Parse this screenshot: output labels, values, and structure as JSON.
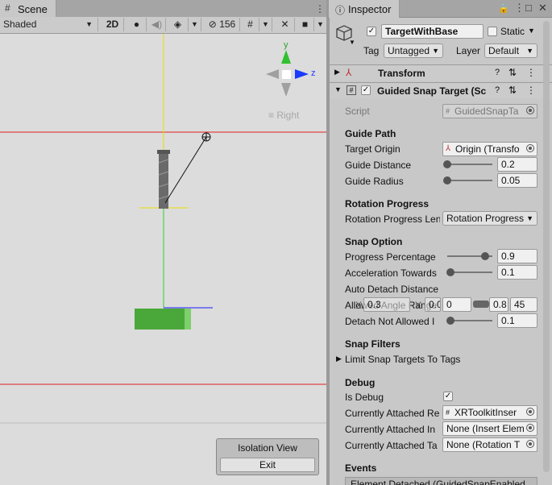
{
  "scene": {
    "tab_label": "Scene",
    "shading_mode": "Shaded",
    "mode_2d": "2D",
    "hidden_count": "156",
    "gizmo_view_label": "Right",
    "gizmo_axis_y": "y",
    "gizmo_axis_z": "z",
    "isolation_title": "Isolation View",
    "isolation_exit": "Exit"
  },
  "inspector": {
    "tab_label": "Inspector",
    "object_name": "TargetWithBase",
    "static_label": "Static",
    "tag_label": "Tag",
    "tag_value": "Untagged",
    "layer_label": "Layer",
    "layer_value": "Default",
    "transform_title": "Transform",
    "component_title": "Guided Snap Target (Sc",
    "script_label": "Script",
    "script_value": "GuidedSnapTa",
    "sections": {
      "guide_path": "Guide Path",
      "rotation_progress": "Rotation Progress",
      "snap_option": "Snap Option",
      "snap_filters": "Snap Filters",
      "debug": "Debug",
      "events": "Events"
    },
    "target_origin_label": "Target Origin",
    "target_origin_value": "Origin (Transfo",
    "guide_distance_label": "Guide Distance",
    "guide_distance_value": "0.2",
    "guide_radius_label": "Guide Radius",
    "guide_radius_value": "0.05",
    "rotation_progress_len_label": "Rotation Progress Len",
    "rotation_progress_len_value": "Rotation Progress",
    "progress_percentage_label": "Progress Percentage",
    "progress_percentage_value": "0.9",
    "acceleration_label": "Acceleration Towards",
    "acceleration_value": "0.1",
    "auto_detach_label": "Auto Detach Distance",
    "allowed_angle_label": "Allowed Angle Range",
    "allowed_x_label": "X",
    "allowed_x_value": "0.3",
    "allowed_y_label": "Y",
    "allowed_y_value": "0.0",
    "allowed_min_value": "0",
    "allowed_max_value": "0.8",
    "allowed_z_value": "45",
    "detach_not_allowed_label": "Detach Not Allowed I",
    "detach_not_allowed_value": "0.1",
    "limit_snap_label": "Limit Snap Targets To Tags",
    "is_debug_label": "Is Debug",
    "attached_r_label": "Currently Attached Re",
    "attached_r_value": "XRToolkitInser",
    "attached_in_label": "Currently Attached In",
    "attached_in_value": "None (Insert Elem",
    "attached_t_label": "Currently Attached Ta",
    "attached_t_value": "None (Rotation T",
    "events_value": "Element Detached (GuidedSnapEnabled"
  }
}
